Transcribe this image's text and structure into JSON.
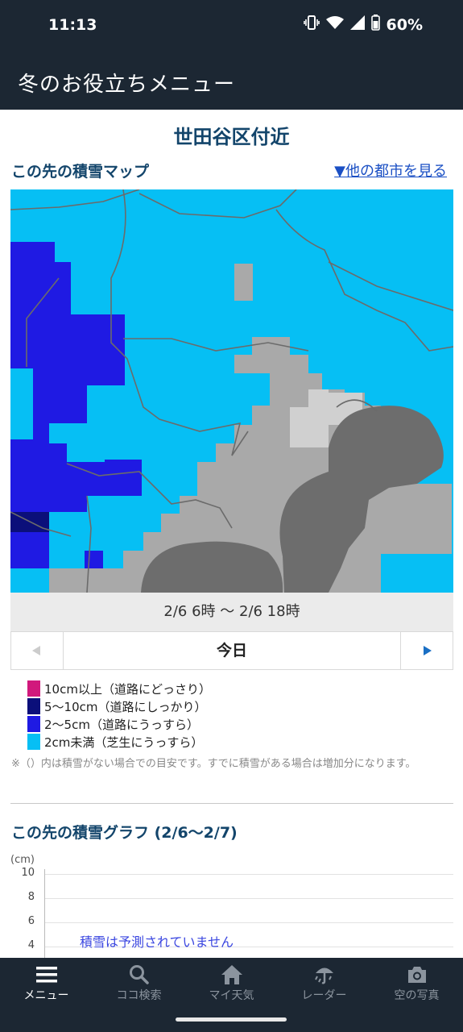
{
  "status": {
    "time": "11:13",
    "battery": "60%"
  },
  "appbar": {
    "title": "冬のお役立ちメニュー"
  },
  "location": "世田谷区付近",
  "map_section": {
    "title": "この先の積雪マップ",
    "other_cities_link": "▼他の都市を見る"
  },
  "period": "2/6 6時 〜 2/6 18時",
  "day_nav": {
    "label": "今日"
  },
  "legend": [
    {
      "label": "10cm以上（道路にどっさり）",
      "color": "#d1197c"
    },
    {
      "label": "5〜10cm（道路にしっかり）",
      "color": "#0b0f7a"
    },
    {
      "label": "2〜5cm（道路にうっすら）",
      "color": "#1f1ae3"
    },
    {
      "label": "2cm未満（芝生にうっすら）",
      "color": "#06bff4"
    }
  ],
  "note": "※（）内は積雪がない場合での目安です。すでに積雪がある場合は増加分になります。",
  "graph": {
    "title": "この先の積雪グラフ (2/6〜2/7)",
    "unit": "(cm)",
    "ticks": [
      "10",
      "8",
      "6",
      "4"
    ],
    "no_data": "積雪は予測されていません"
  },
  "colors": {
    "header_bg": "#1c2733",
    "accent": "#13456b",
    "link": "#1a4fc4",
    "snow_light": "#06bff4",
    "snow_mid": "#1f1ae3",
    "snow_deep": "#0b0f7a",
    "no_snow": "#a9a9a9",
    "sea": "#6d6d6d"
  },
  "bottom_nav": [
    {
      "label": "メニュー",
      "icon": "menu-icon",
      "active": true
    },
    {
      "label": "ココ検索",
      "icon": "search-icon",
      "active": false
    },
    {
      "label": "マイ天気",
      "icon": "home-icon",
      "active": false
    },
    {
      "label": "レーダー",
      "icon": "radar-icon",
      "active": false
    },
    {
      "label": "空の写真",
      "icon": "camera-icon",
      "active": false
    }
  ]
}
